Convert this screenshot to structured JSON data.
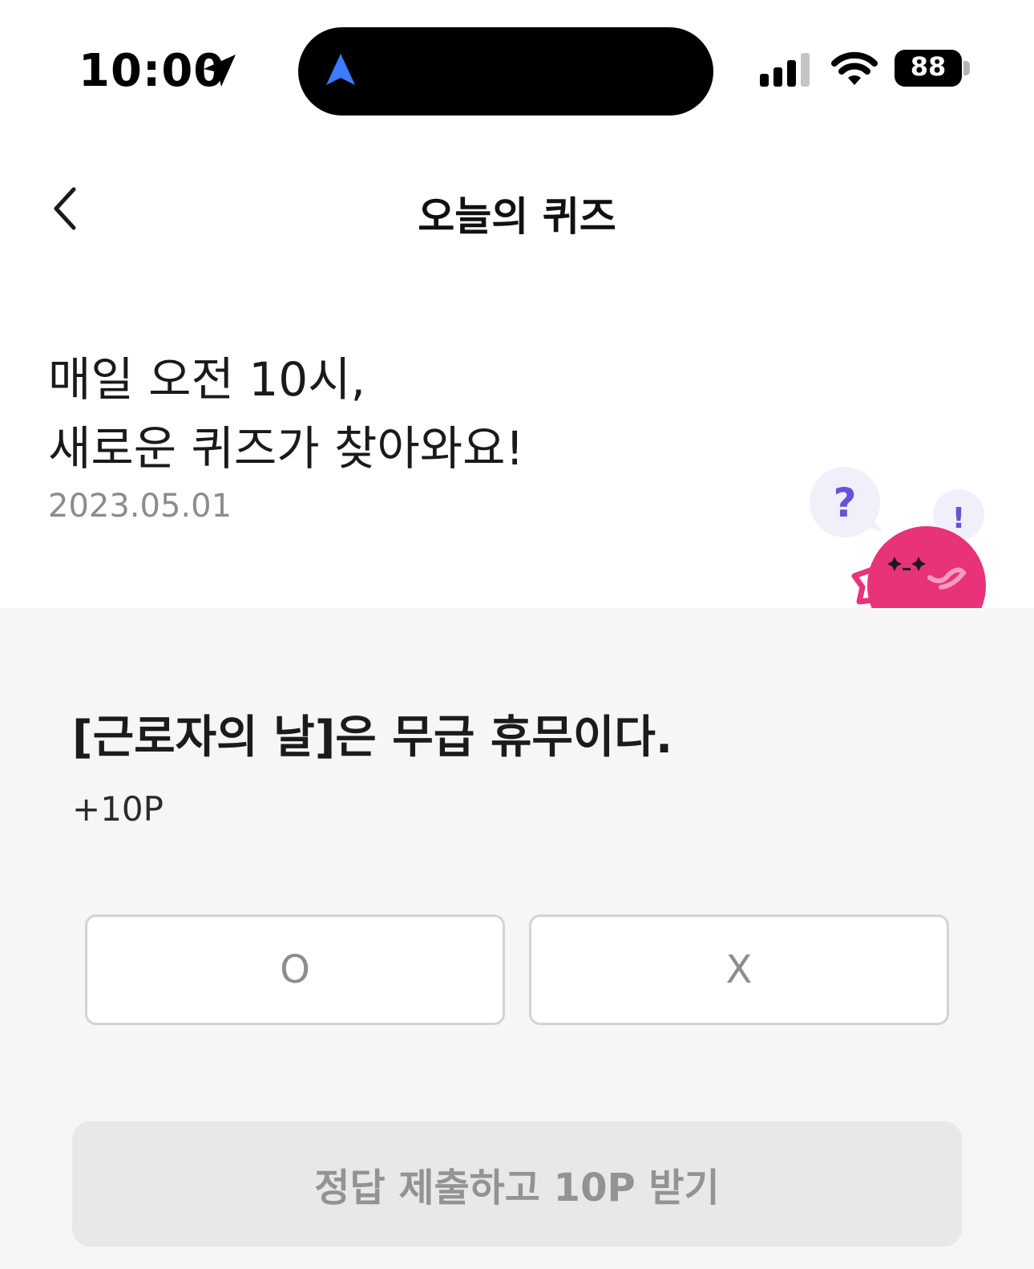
{
  "status_bar": {
    "time": "10:00",
    "battery": "88"
  },
  "header": {
    "title": "오늘의 퀴즈"
  },
  "intro": {
    "line1": "매일 오전 10시,",
    "line2": "새로운 퀴즈가 찾아와요!",
    "date": "2023.05.01"
  },
  "mascot": {
    "question_mark": "?",
    "exclamation_mark": "!"
  },
  "quiz": {
    "question": "[근로자의 날]은 무급 휴무이다.",
    "points": "+10P",
    "options": [
      "O",
      "X"
    ],
    "submit_label": "정답 제출하고 10P 받기"
  },
  "colors": {
    "accent_pink": "#e8327a",
    "accent_purple": "#6b4fd8",
    "nav_blue": "#3d7bff"
  }
}
